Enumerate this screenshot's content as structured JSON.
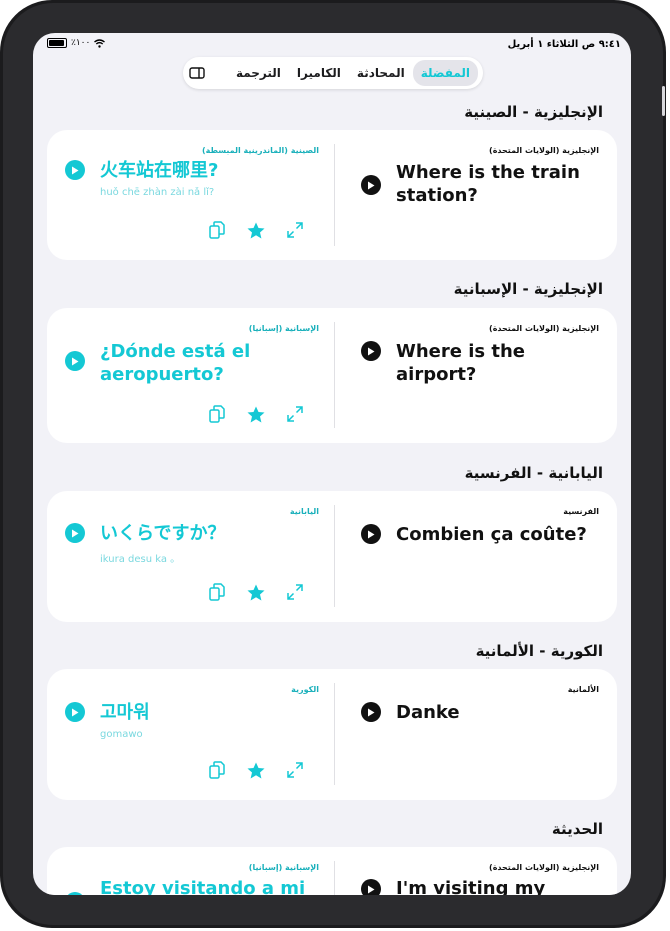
{
  "status_bar": {
    "time": "٩:٤١ ص  الثلاثاء ١ أبريل",
    "battery": "٪١٠٠"
  },
  "tabs": {
    "favorites": "المفضلة",
    "conversation": "المحادثة",
    "camera": "الكاميرا",
    "translation": "الترجمة"
  },
  "accent_color": "#14c8d4",
  "sections": [
    {
      "title": "الإنجليزية - الصينية",
      "card": {
        "left_lang": "الصينية (الماندرينية المبسطة)",
        "left_phrase": "火车站在哪里?",
        "left_translit": "huǒ chē zhàn zài nǎ lǐ?",
        "right_lang": "الإنجليزية (الولايات المتحدة)",
        "right_phrase": "Where is the train station?"
      }
    },
    {
      "title": "الإنجليزية - الإسبانية",
      "card": {
        "left_lang": "الإسبانية (إسبانيا)",
        "left_phrase": "¿Dónde está el aeropuerto?",
        "left_translit": "",
        "right_lang": "الإنجليزية (الولايات المتحدة)",
        "right_phrase": "Where is the airport?"
      }
    },
    {
      "title": "اليابانية - الفرنسية",
      "card": {
        "left_lang": "اليابانية",
        "left_phrase": "いくらですか？",
        "left_translit": "ikura desu ka 。",
        "right_lang": "الفرنسية",
        "right_phrase": "Combien ça coûte?"
      }
    },
    {
      "title": "الكورية - الألمانية",
      "card": {
        "left_lang": "الكورية",
        "left_phrase": "고마워",
        "left_translit": "gomawo",
        "right_lang": "الألمانية",
        "right_phrase": "Danke"
      }
    },
    {
      "title": "الحديثة",
      "card": {
        "left_lang": "الإسبانية (إسبانيا)",
        "left_phrase": "Estoy visitando a mi",
        "left_translit": "",
        "right_lang": "الإنجليزية (الولايات المتحدة)",
        "right_phrase": "I'm visiting my friend"
      }
    }
  ],
  "icons": {
    "play": "play-icon",
    "copy": "copy-icon",
    "favorite": "star-icon",
    "expand": "expand-icon",
    "sidebar": "sidebar-icon",
    "wifi": "wifi-icon",
    "battery": "battery-icon"
  }
}
